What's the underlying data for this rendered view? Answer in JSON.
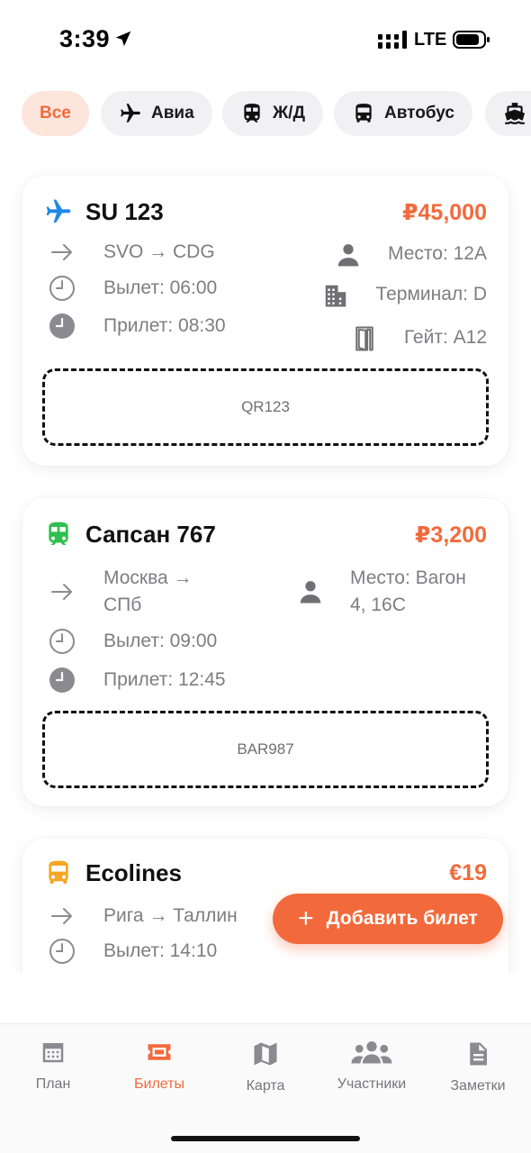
{
  "status_bar": {
    "time": "3:39",
    "network": "LTE"
  },
  "filters": [
    {
      "label": "Все",
      "icon": "",
      "active": true
    },
    {
      "label": "Авиа",
      "icon": "plane-icon",
      "active": false
    },
    {
      "label": "Ж/Д",
      "icon": "train-icon",
      "active": false
    },
    {
      "label": "Автобус",
      "icon": "bus-icon",
      "active": false
    },
    {
      "label": "",
      "icon": "ship-icon",
      "active": false
    }
  ],
  "tickets": [
    {
      "type": "plane",
      "icon_color": "#1e88e5",
      "title": "SU 123",
      "price": "₽45,000",
      "route": "SVO → CDG",
      "departure": "Вылет: 06:00",
      "arrival": "Прилет: 08:30",
      "seat": "Место: 12A",
      "terminal": "Терминал: D",
      "gate": "Гейт: A12",
      "code": "QR123"
    },
    {
      "type": "train",
      "icon_color": "#2fbf4f",
      "title": "Сапсан 767",
      "price": "₽3,200",
      "route_line1": "Москва →",
      "route_line2": "СПб",
      "departure": "Вылет: 09:00",
      "arrival": "Прилет: 12:45",
      "seat_line1": "Место: Вагон",
      "seat_line2": "4, 16C",
      "code": "BAR987"
    },
    {
      "type": "bus",
      "icon_color": "#f5a623",
      "title": "Ecolines",
      "price": "€19",
      "route": "Рига → Таллин",
      "departure": "Вылет: 14:10"
    }
  ],
  "fab": {
    "label": "Добавить билет"
  },
  "tabbar": {
    "items": [
      {
        "label": "План",
        "icon": "calendar-icon",
        "active": false
      },
      {
        "label": "Билеты",
        "icon": "ticket-icon",
        "active": true
      },
      {
        "label": "Карта",
        "icon": "map-icon",
        "active": false
      },
      {
        "label": "Участники",
        "icon": "people-icon",
        "active": false
      },
      {
        "label": "Заметки",
        "icon": "note-icon",
        "active": false
      }
    ]
  },
  "colors": {
    "accent": "#f26a3c",
    "accent_bg": "#fde5dc",
    "muted_text": "#7d7d83"
  }
}
